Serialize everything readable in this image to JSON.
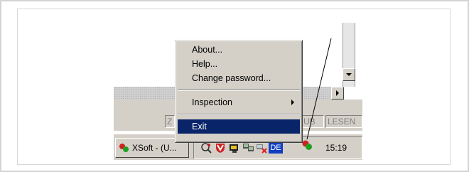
{
  "menu": {
    "items": [
      {
        "label": "About..."
      },
      {
        "label": "Help..."
      },
      {
        "label": "Change password..."
      },
      {
        "label": "Inspection"
      },
      {
        "label": "Exit"
      }
    ]
  },
  "statusbar": {
    "panels": [
      {
        "text": "Z"
      },
      {
        "text": "UB"
      },
      {
        "text": "LESEN"
      }
    ]
  },
  "taskbar": {
    "task_label": "XSoft - (U...",
    "tray_lang": "DE",
    "clock": "15:19"
  },
  "colors": {
    "menu_highlight": "#0a246a",
    "face": "#d4d0c8",
    "tray_lang_bg": "#1040c0"
  }
}
